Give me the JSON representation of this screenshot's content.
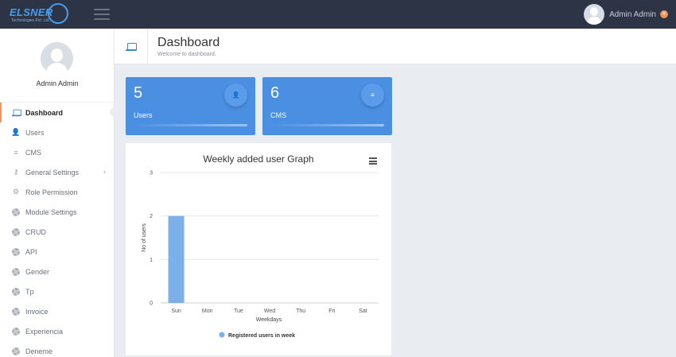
{
  "brand": {
    "name": "ELSNER",
    "tagline": "Technologies Pvt. Ltd."
  },
  "topbar": {
    "user_name": "Admin Admin",
    "menu_icon": "hamburger-icon"
  },
  "sidebar": {
    "profile_name": "Admin Admin",
    "items": [
      {
        "label": "Dashboard",
        "icon": "laptop-icon",
        "active": true
      },
      {
        "label": "Users",
        "icon": "users-icon"
      },
      {
        "label": "CMS",
        "icon": "list-icon"
      },
      {
        "label": "General Settings",
        "icon": "key-icon",
        "has_submenu": true
      },
      {
        "label": "Role Permission",
        "icon": "role-icon"
      },
      {
        "label": "Module Settings",
        "icon": "gear-icon"
      },
      {
        "label": "CRUD",
        "icon": "gear-icon"
      },
      {
        "label": "API",
        "icon": "gear-icon"
      },
      {
        "label": "Gender",
        "icon": "gear-icon"
      },
      {
        "label": "Tp",
        "icon": "gear-icon"
      },
      {
        "label": "Invoice",
        "icon": "gear-icon"
      },
      {
        "label": "Experiencia",
        "icon": "gear-icon"
      },
      {
        "label": "Deneme",
        "icon": "gear-icon"
      }
    ]
  },
  "header": {
    "title": "Dashboard",
    "subtitle": "Welcome to dashboard."
  },
  "cards": [
    {
      "count": "5",
      "label": "Users",
      "icon": "users-icon",
      "color": "#4a8fe2"
    },
    {
      "count": "6",
      "label": "CMS",
      "icon": "list-icon",
      "color": "#4a8fe2"
    }
  ],
  "chart_data": {
    "type": "bar",
    "title": "Weekly added user Graph",
    "xlabel": "Weekdays",
    "ylabel": "No of users",
    "categories": [
      "Sun",
      "Mon",
      "Tue",
      "Wed",
      "Thu",
      "Fri",
      "Sat"
    ],
    "series": [
      {
        "name": "Registered users in week",
        "values": [
          2,
          0,
          0,
          0,
          0,
          0,
          0
        ],
        "color": "#7cb0ea"
      }
    ],
    "ylim": [
      0,
      3
    ],
    "yticks": [
      "0",
      "1",
      "2",
      "3"
    ],
    "grid": true,
    "legend": "bottom"
  }
}
